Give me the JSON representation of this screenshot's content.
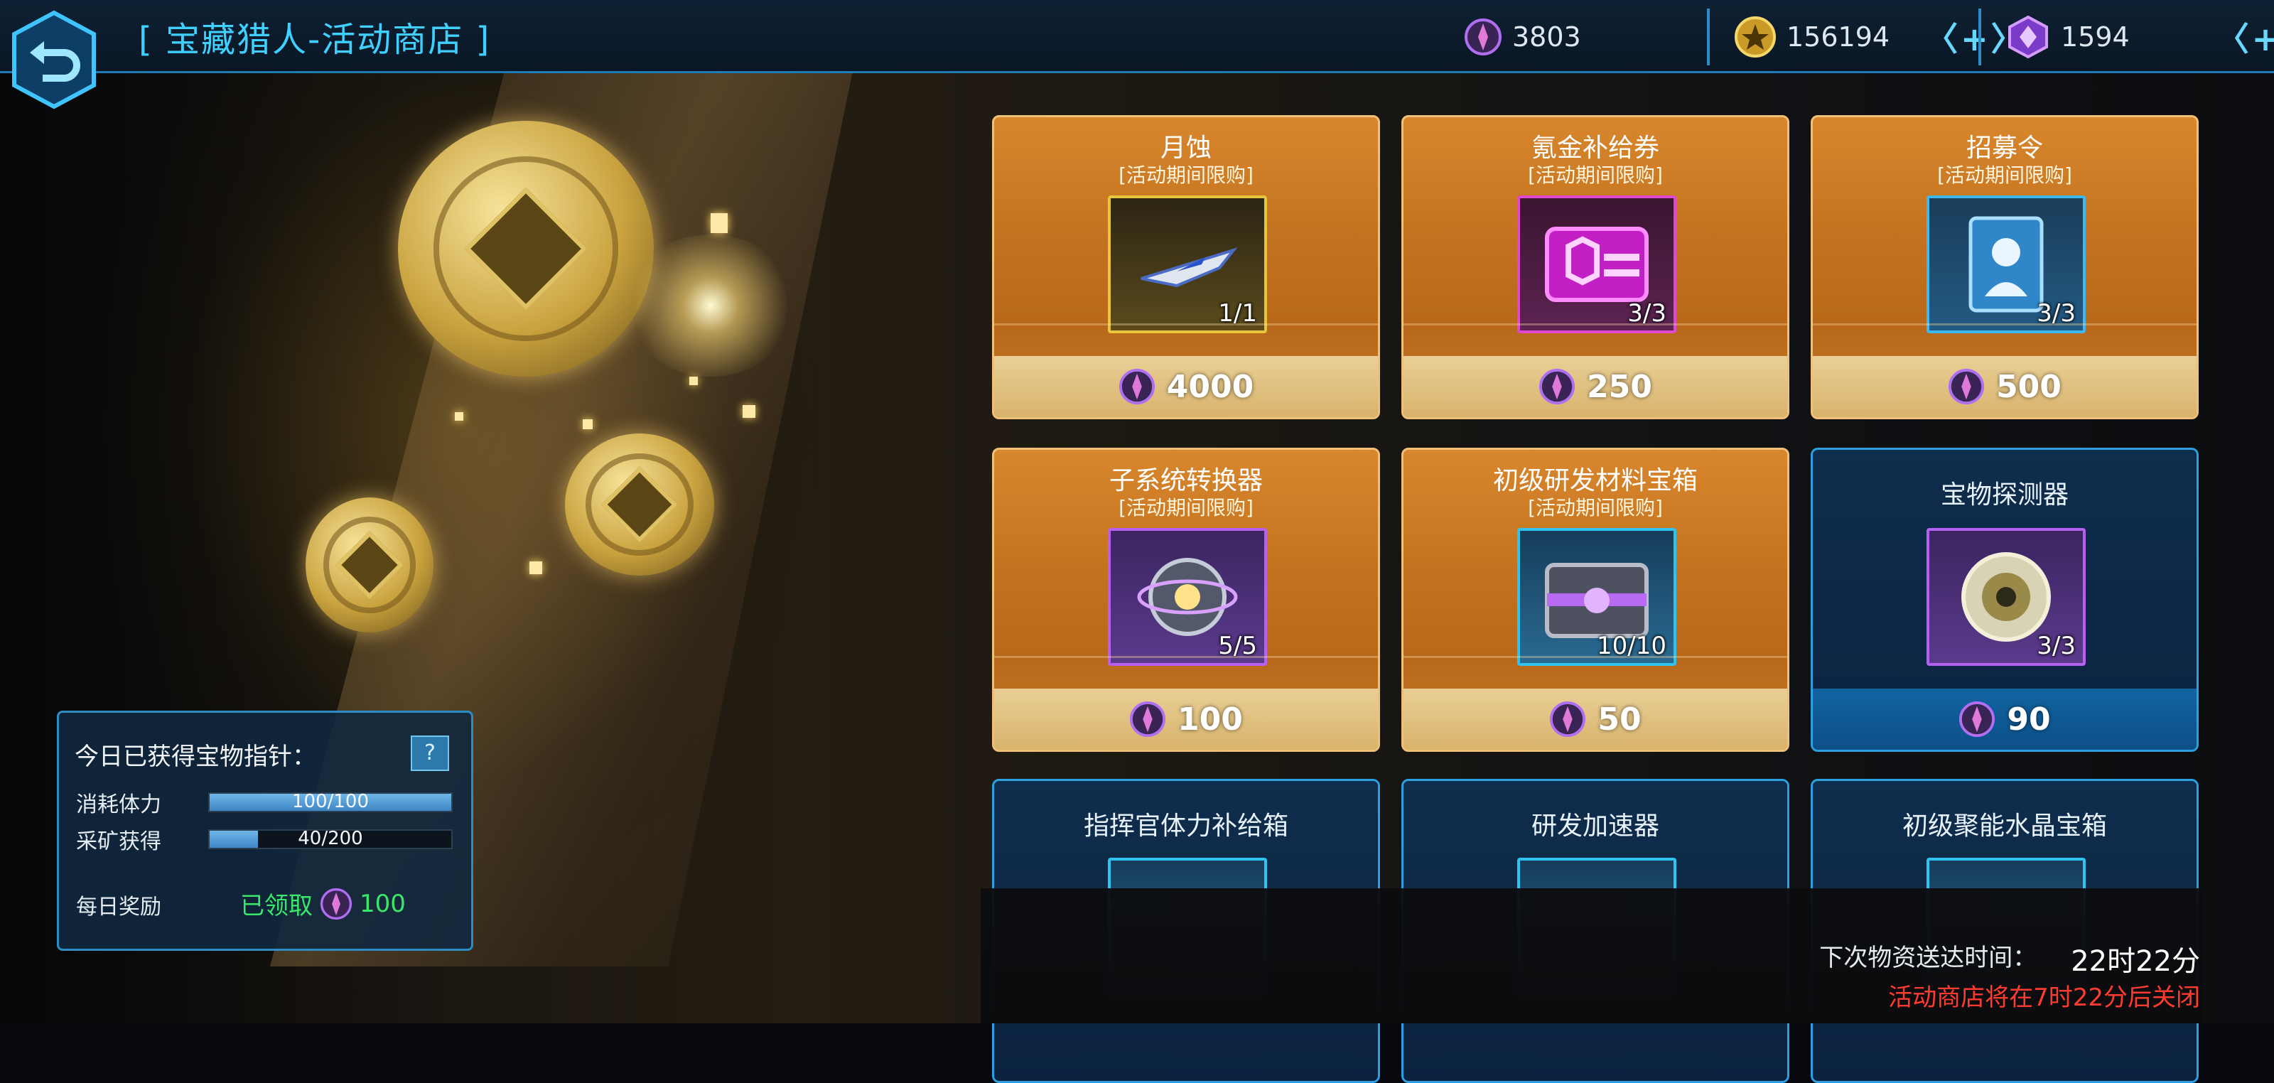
{
  "header": {
    "title": "[ 宝藏猎人-活动商店 ]",
    "currencies": [
      {
        "icon": "crystal-token-icon",
        "value": "3803"
      },
      {
        "icon": "gold-coin-icon",
        "value": "156194",
        "plus": "〈+〉"
      },
      {
        "icon": "purple-gem-icon",
        "value": "1594",
        "plus": "〈+〉"
      }
    ]
  },
  "info_panel": {
    "title": "今日已获得宝物指针：",
    "help": "?",
    "stamina_label": "消耗体力",
    "stamina_value": "100/100",
    "stamina_fraction": 1.0,
    "mining_label": "采矿获得",
    "mining_value": "40/200",
    "mining_fraction": 0.2,
    "daily_label": "每日奖励",
    "daily_status": "已领取",
    "daily_amount": "100"
  },
  "shop": {
    "items": [
      {
        "name": "月蚀",
        "limit": "[活动期间限购]",
        "qty": "1/1",
        "price": "4000",
        "icon": "spaceship-icon",
        "style": "orange",
        "quality": "gold"
      },
      {
        "name": "氪金补给券",
        "limit": "[活动期间限购]",
        "qty": "3/3",
        "price": "250",
        "icon": "voucher-icon",
        "style": "orange",
        "quality": "pink"
      },
      {
        "name": "招募令",
        "limit": "[活动期间限购]",
        "qty": "3/3",
        "price": "500",
        "icon": "recruit-card-icon",
        "style": "orange",
        "quality": "blue"
      },
      {
        "name": "子系统转换器",
        "limit": "[活动期间限购]",
        "qty": "5/5",
        "price": "100",
        "icon": "converter-orb-icon",
        "style": "orange",
        "quality": "purple"
      },
      {
        "name": "初级研发材料宝箱",
        "limit": "[活动期间限购]",
        "qty": "10/10",
        "price": "50",
        "icon": "treasure-chest-icon",
        "style": "orange",
        "quality": "cyan"
      },
      {
        "name": "宝物探测器",
        "limit": "",
        "qty": "3/3",
        "price": "90",
        "icon": "detector-disc-icon",
        "style": "blue",
        "quality": "purple"
      },
      {
        "name": "指挥官体力补给箱",
        "style": "blue"
      },
      {
        "name": "研发加速器",
        "style": "blue"
      },
      {
        "name": "初级聚能水晶宝箱",
        "style": "blue"
      }
    ]
  },
  "footer": {
    "next_label": "下次物资送达时间：",
    "next_value": "22时22分",
    "close_notice": "活动商店将在7时22分后关闭"
  },
  "colors": {
    "accent": "#3fd0ff",
    "card_orange": "#c3721f",
    "card_blue": "#0f2d4c",
    "claimed_green": "#39e86a",
    "warning_red": "#ff3b2f"
  }
}
